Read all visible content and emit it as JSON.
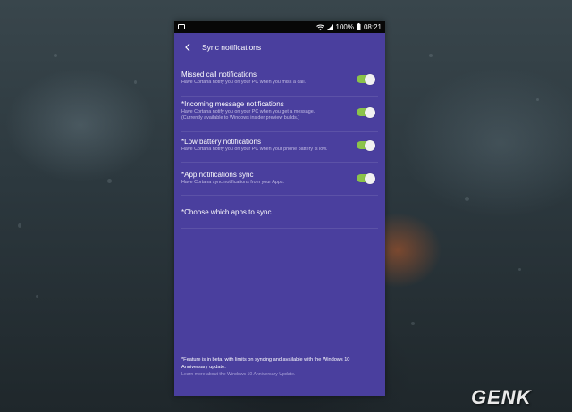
{
  "status_bar": {
    "battery": "100%",
    "time": "08:21"
  },
  "app_bar": {
    "title": "Sync notifications"
  },
  "settings": [
    {
      "title": "Missed call notifications",
      "description": "Have Cortana notify you on your PC when you miss a call.",
      "enabled": true
    },
    {
      "title": "*Incoming message notifications",
      "description": "Have Cortana notify you on your PC when you get a message.",
      "description2": "(Currently available to Windows insider preview builds.)",
      "enabled": true
    },
    {
      "title": "*Low battery notifications",
      "description": "Have Cortana notify you on your PC when your phone battery is low.",
      "enabled": true
    },
    {
      "title": "*App notifications sync",
      "description": "Have Cortana sync notifications from your Apps.",
      "enabled": true
    }
  ],
  "choose_apps": {
    "label": "*Choose which apps to sync"
  },
  "footer": {
    "note_line1": "*Feature is in beta, with limits on syncing and available with the Windows 10",
    "note_line2": "Anniversary update.",
    "link": "Learn more about the Windows 10 Anniversary Update."
  },
  "logo": "GENK",
  "colors": {
    "panel": "#4a3f9e",
    "toggle_on": "#8bc34a",
    "status_bar": "#070707"
  }
}
